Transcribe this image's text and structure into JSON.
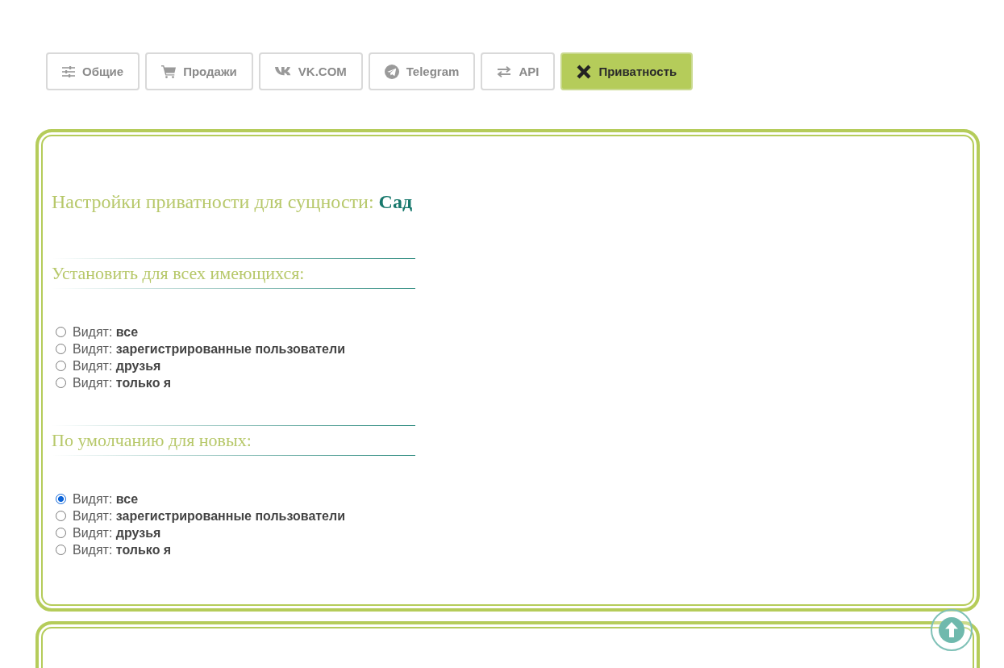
{
  "tabs": [
    {
      "label": "Общие",
      "selected": false
    },
    {
      "label": "Продажи",
      "selected": false
    },
    {
      "label": "VK.COM",
      "selected": false
    },
    {
      "label": "Telegram",
      "selected": false
    },
    {
      "label": "API",
      "selected": false
    },
    {
      "label": "Приватность",
      "selected": true
    }
  ],
  "privacy_panel": {
    "title": "Настройки приватности для сущности: **Сад**",
    "groups": [
      {
        "heading": "Установить для всех имеющихся:",
        "options": [
          {
            "label": "Видят: **все**",
            "selected": false
          },
          {
            "label": "Видят: **зарегистрированные пользователи**",
            "selected": false
          },
          {
            "label": "Видят: **друзья**",
            "selected": false
          },
          {
            "label": "Видят: **только я**",
            "selected": false
          }
        ]
      },
      {
        "heading": "По умолчанию для новых:",
        "options": [
          {
            "label": "Видят: **все**",
            "selected": true
          },
          {
            "label": "Видят: **зарегистрированные пользователи**",
            "selected": false
          },
          {
            "label": "Видят: **друзья**",
            "selected": false
          },
          {
            "label": "Видят: **только я**",
            "selected": false
          }
        ]
      }
    ]
  }
}
